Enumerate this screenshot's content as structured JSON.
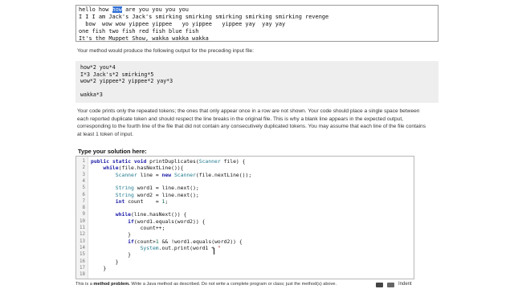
{
  "input_lines": [
    [
      "hello how ",
      "how",
      " are you you you you"
    ],
    [
      "I I I am Jack's Jack's smirking smirking smirking smirking smirking revenge",
      "",
      ""
    ],
    [
      "  bow  wow wow yippee yippee   yo yippee   yippee yay  yay yay",
      "",
      ""
    ],
    [
      "one fish two fish red fish blue fish",
      "",
      ""
    ],
    [
      "It's the Muppet Show, wakka wakka wakka",
      "",
      ""
    ]
  ],
  "intro_text": "Your method would produce the following output for the preceding input file:",
  "output_lines": [
    "how*2 you*4",
    "I*3 Jack's*2 smirking*5",
    "wow*2 yippee*2 yippee*2 yay*3",
    "",
    "wakka*3"
  ],
  "explanation_text": "Your code prints only the repeated tokens; the ones that only appear once in a row are not shown. Your code should place a single space between each reported duplicate token and should respect the line breaks in the original file. This is why a blank line appears in the expected output, corresponding to the fourth line of the file that did not contain any consecutively duplicated tokens. You may assume that each line of the file contains at least 1 token of input.",
  "solution_title": "Type your solution here:",
  "code_lines": [
    "public static void printDuplicates(Scanner file) {",
    "    while(file.hasNextLine()){",
    "        Scanner line = new Scanner(file.nextLine());",
    "",
    "        String word1 = line.next();",
    "        String word2 = line.next();",
    "        int count    = 1;",
    "",
    "        while(line.hasNext()) {",
    "            if(word1.equals(word2)) {",
    "                count++;",
    "            }",
    "            if(count>1 && !word1.equals(word2)) {",
    "                System.out.print(word1 + \"",
    "            }",
    "        }",
    "    }",
    ""
  ],
  "footer": {
    "prefix": "This is a ",
    "bold": "method problem.",
    "suffix": " Write a Java method as described. Do not write a complete program or class; just the method(s) above.",
    "indent_label": "Indent"
  }
}
